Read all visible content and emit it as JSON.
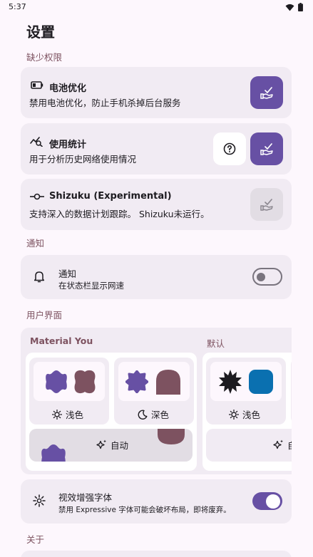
{
  "status_bar": {
    "time": "5:37",
    "wifi_icon": "wifi-icon",
    "battery_icon": "battery-icon"
  },
  "page_title": "设置",
  "sections": {
    "permissions": "缺少权限",
    "notifications": "通知",
    "ui": "用户界面",
    "about": "关于"
  },
  "permissions": {
    "battery": {
      "title": "电池优化",
      "subtitle": "禁用电池优化，防止手机杀掉后台服务",
      "icon": "battery-low-icon",
      "action_icon": "grant-hand-check-icon"
    },
    "usage": {
      "title": "使用统计",
      "subtitle": "用于分析历史网络使用情况",
      "icon": "usage-stats-icon",
      "help_icon": "help-circle-icon",
      "action_icon": "grant-hand-check-icon"
    },
    "shizuku": {
      "title": "Shizuku (Experimental)",
      "subtitle": "支持深入的数据计划跟踪。 Shizuku未运行。",
      "icon": "commit-icon",
      "action_icon": "grant-hand-check-icon",
      "disabled": true
    }
  },
  "notification": {
    "title": "通知",
    "subtitle": "在状态栏显示网速",
    "icon": "bell-icon",
    "enabled": false
  },
  "theme": {
    "material_you": {
      "label": "Material You",
      "light_label": "浅色",
      "dark_label": "深色",
      "auto_label": "自动",
      "primary": "#6750a4",
      "secondary": "#7d5260"
    },
    "default": {
      "label": "默认",
      "light_label": "浅色",
      "auto_label": "自",
      "primary": "#1d1b20",
      "secondary": "#0a70b0"
    }
  },
  "expressive_font": {
    "title": "视效增强字体",
    "subtitle": "禁用 Expressive 字体可能会破坏布局，即将废弃。",
    "icon": "sparkle-icon",
    "enabled": true
  },
  "colors": {
    "accent": "#6750a4",
    "section_label": "#7d5260",
    "card_bg": "#f1ebf3",
    "page_bg": "#fdf7fd"
  }
}
